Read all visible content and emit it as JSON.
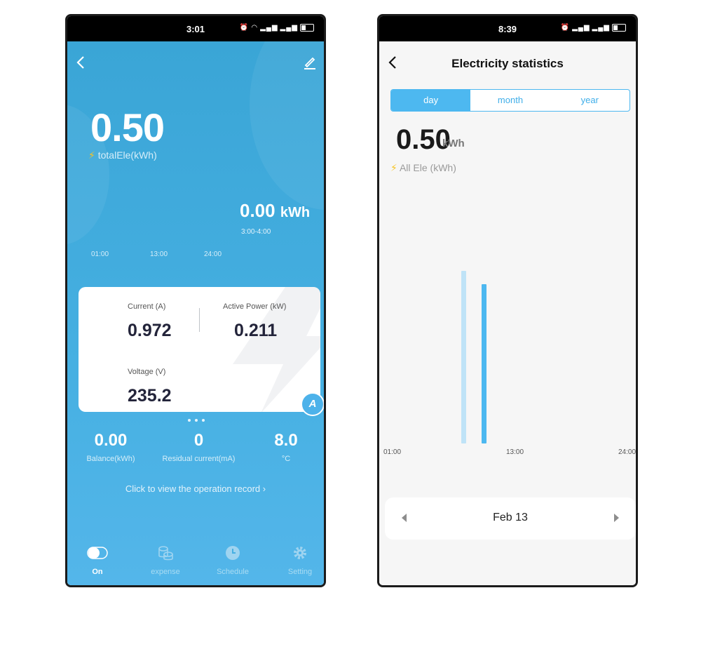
{
  "screen1": {
    "status": {
      "time": "3:01",
      "icons": [
        "alarm-icon",
        "wifi-icon",
        "signal-icon",
        "signal-icon",
        "battery-icon"
      ]
    },
    "total": {
      "value": "0.50",
      "label": "totalEle(kWh)"
    },
    "current_usage": {
      "value": "0.00",
      "unit": "kWh",
      "range": "3:00-4:00"
    },
    "axis": [
      "01:00",
      "13:00",
      "24:00"
    ],
    "card": {
      "current_label": "Current (A)",
      "current_value": "0.972",
      "power_label": "Active Power (kW)",
      "power_value": "0.211",
      "voltage_label": "Voltage (V)",
      "voltage_value": "235.2",
      "badge": "A"
    },
    "stats": [
      {
        "value": "0.00",
        "label": "Balance(kWh)"
      },
      {
        "value": "0",
        "label": "Residual current(mA)"
      },
      {
        "value": "8.0",
        "label": "°C"
      }
    ],
    "operation_link": "Click to view the operation record ›",
    "tabs": [
      {
        "label": "On",
        "icon": "toggle-icon"
      },
      {
        "label": "expense",
        "icon": "coins-icon"
      },
      {
        "label": "Schedule",
        "icon": "clock-icon"
      },
      {
        "label": "Setting",
        "icon": "gear-icon"
      }
    ]
  },
  "screen2": {
    "status": {
      "time": "8:39",
      "icons": [
        "alarm-icon",
        "signal-icon",
        "signal-icon",
        "battery-icon"
      ]
    },
    "title": "Electricity statistics",
    "segments": [
      "day",
      "month",
      "year"
    ],
    "selected_segment": "day",
    "total": {
      "value": "0.50",
      "unit": "kWh",
      "label": "All Ele (kWh)"
    },
    "axis": [
      "01:00",
      "13:00",
      "24:00"
    ],
    "date": "Feb 13",
    "colors": {
      "accent": "#4db8f0",
      "bar_light": "#bfe3f7"
    }
  }
}
